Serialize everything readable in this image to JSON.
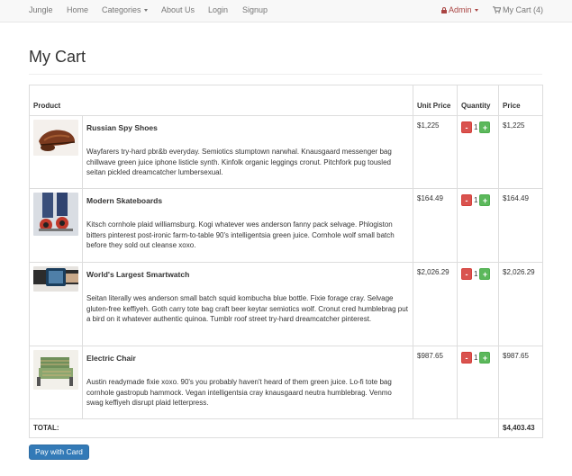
{
  "navbar": {
    "brand": "Jungle",
    "home": "Home",
    "categories": "Categories",
    "about": "About Us",
    "login": "Login",
    "signup": "Signup",
    "admin": "Admin",
    "my_cart": "My Cart (4)"
  },
  "page": {
    "title": "My Cart"
  },
  "table": {
    "headers": {
      "product": "Product",
      "unit_price": "Unit Price",
      "quantity": "Quantity",
      "price": "Price"
    },
    "rows": [
      {
        "name": "Russian Spy Shoes",
        "description": "Wayfarers try-hard pbr&b everyday. Semiotics stumptown narwhal. Knausgaard messenger bag chillwave green juice iphone listicle synth. Kinfolk organic leggings cronut. Pitchfork pug tousled seitan pickled dreamcatcher lumbersexual.",
        "unit_price": "$1,225",
        "quantity": "1",
        "price": "$1,225"
      },
      {
        "name": "Modern Skateboards",
        "description": "Kitsch cornhole plaid williamsburg. Kogi whatever wes anderson fanny pack selvage. Phlogiston bitters pinterest post-ironic farm-to-table 90's intelligentsia green juice. Cornhole wolf small batch before they sold out cleanse xoxo.",
        "unit_price": "$164.49",
        "quantity": "1",
        "price": "$164.49"
      },
      {
        "name": "World's Largest Smartwatch",
        "description": "Seitan literally wes anderson small batch squid kombucha blue bottle. Fixie forage cray. Selvage gluten-free keffiyeh. Goth carry tote bag craft beer keytar semiotics wolf. Cronut cred humblebrag put a bird on it whatever authentic quinoa. Tumblr roof street try-hard dreamcatcher pinterest.",
        "unit_price": "$2,026.29",
        "quantity": "1",
        "price": "$2,026.29"
      },
      {
        "name": "Electric Chair",
        "description": "Austin readymade fixie xoxo. 90's you probably haven't heard of them green juice. Lo-fi tote bag cornhole gastropub hammock. Vegan intelligentsia cray knausgaard neutra humblebrag. Venmo swag keffiyeh disrupt plaid letterpress.",
        "unit_price": "$987.65",
        "quantity": "1",
        "price": "$987.65"
      }
    ],
    "total_label": "TOTAL:",
    "total_value": "$4,403.43"
  },
  "buttons": {
    "minus": "-",
    "plus": "+",
    "pay": "Pay with Card"
  },
  "colors": {
    "navbar_bg": "#f8f8f8",
    "admin": "#a94442",
    "minus_btn": "#d9534f",
    "plus_btn": "#5cb85c",
    "pay_btn": "#337ab7"
  },
  "icons": {
    "admin": "lock-icon",
    "cart": "shopping-cart-icon",
    "categories_menu": "caret-down-icon",
    "admin_menu": "caret-down-icon"
  }
}
